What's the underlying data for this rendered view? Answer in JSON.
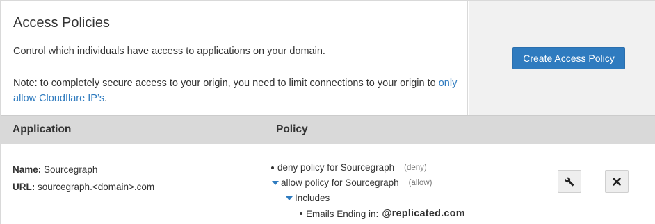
{
  "header": {
    "title": "Access Policies",
    "description": "Control which individuals have access to applications on your domain.",
    "note_prefix": "Note: to completely secure access to your origin, you need to limit connections to your origin to ",
    "note_link": "only allow Cloudflare IP’s",
    "note_suffix": ".",
    "create_button_label": "Create Access Policy"
  },
  "table": {
    "columns": [
      "Application",
      "Policy"
    ],
    "rows": [
      {
        "name_label": "Name:",
        "name_value": "Sourcegraph",
        "url_label": "URL:",
        "url_value": "sourcegraph.<domain>.com",
        "policies": [
          {
            "name": "deny policy for Sourcegraph",
            "action": "(deny)"
          },
          {
            "name": "allow policy for Sourcegraph",
            "action": "(allow)"
          }
        ],
        "includes_label": "Includes",
        "rule_label": "Emails Ending in:",
        "rule_value": "@replicated.com",
        "edit_icon": "wrench-icon",
        "delete_icon": "close-icon"
      }
    ]
  },
  "colors": {
    "accent": "#2f7bbf",
    "header_bg": "#d9d9d9",
    "panel_bg": "#f1f1f1"
  }
}
